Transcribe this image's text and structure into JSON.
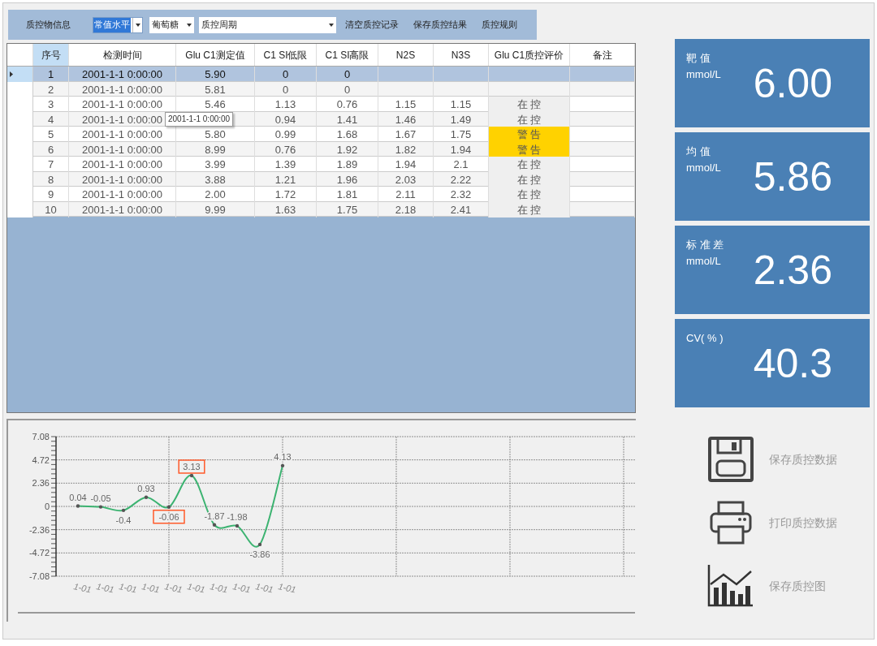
{
  "toolbar": {
    "label": "质控物信息",
    "level_select": {
      "value": "常值水平",
      "highlighted": true
    },
    "analyte_select": {
      "value": "葡萄糖"
    },
    "period_select": {
      "value": "质控周期"
    },
    "buttons": [
      "清空质控记录",
      "保存质控结果",
      "质控规则"
    ]
  },
  "table": {
    "columns": [
      {
        "label": "序号",
        "selected": true
      },
      {
        "label": "检测时间",
        "selected": false
      },
      {
        "label": "Glu C1测定值",
        "selected": false
      },
      {
        "label": "C1 SI低限",
        "selected": false
      },
      {
        "label": "C1 SI高限",
        "selected": false
      },
      {
        "label": "N2S",
        "selected": false
      },
      {
        "label": "N3S",
        "selected": false
      },
      {
        "label": "Glu C1质控评价",
        "selected": false
      },
      {
        "label": "备注",
        "selected": false
      }
    ],
    "rows": [
      {
        "selected": true,
        "cells": [
          "1",
          "2001-1-1 0:00:00",
          "5.90",
          "0",
          "0"
        ]
      },
      {
        "selected": false,
        "cells": [
          "2",
          "2001-1-1 0:00:00",
          "5.81",
          "0",
          "0"
        ]
      },
      {
        "selected": false,
        "cells": [
          "3",
          "2001-1-1 0:00:00",
          "5.46",
          "1.13",
          "0.76",
          "1.15",
          "1.15"
        ],
        "evaluation": {
          "text": "在 控",
          "kind": "normal"
        }
      },
      {
        "selected": false,
        "cells": [
          "4",
          "2001-1-1 0:00:00",
          null,
          "0.94",
          "1.41",
          "1.46",
          "1.49"
        ],
        "evaluation": {
          "text": "在 控",
          "kind": "normal"
        }
      },
      {
        "selected": false,
        "cells": [
          "5",
          "2001-1-1 0:00:00",
          "5.80",
          "0.99",
          "1.68",
          "1.67",
          "1.75"
        ],
        "evaluation": {
          "text": "警 告",
          "kind": "warning"
        }
      },
      {
        "selected": false,
        "cells": [
          "6",
          "2001-1-1 0:00:00",
          "8.99",
          "0.76",
          "1.92",
          "1.82",
          "1.94"
        ],
        "evaluation": {
          "text": "警 告",
          "kind": "warning"
        }
      },
      {
        "selected": false,
        "cells": [
          "7",
          "2001-1-1 0:00:00",
          "3.99",
          "1.39",
          "1.89",
          "1.94",
          "2.1"
        ],
        "evaluation": {
          "text": "在 控",
          "kind": "normal"
        }
      },
      {
        "selected": false,
        "cells": [
          "8",
          "2001-1-1 0:00:00",
          "3.88",
          "1.21",
          "1.96",
          "2.03",
          "2.22"
        ],
        "evaluation": {
          "text": "在 控",
          "kind": "normal"
        }
      },
      {
        "selected": false,
        "cells": [
          "9",
          "2001-1-1 0:00:00",
          "2.00",
          "1.72",
          "1.81",
          "2.11",
          "2.32"
        ],
        "evaluation": {
          "text": "在 控",
          "kind": "normal"
        }
      },
      {
        "selected": false,
        "cells": [
          "10",
          "2001-1-1 0:00:00",
          "9.99",
          "1.63",
          "1.75",
          "2.18",
          "2.41"
        ],
        "evaluation": {
          "text": "在 控",
          "kind": "normal"
        }
      }
    ],
    "tooltip": "2001-1-1 0:00:00"
  },
  "chart": {
    "chart_data": {
      "type": "line",
      "categories": [
        "1-01",
        "1-01",
        "1-01",
        "1-01",
        "1-01",
        "1-01",
        "1-01",
        "1-01",
        "1-01",
        "1-01"
      ],
      "series": [
        {
          "color": "#3cb371",
          "values": [
            0.04,
            -0.05,
            -0.4,
            0.93,
            -0.06,
            3.13,
            -1.87,
            -1.98,
            -3.86,
            4.13
          ]
        }
      ],
      "ylim": [
        -7.08,
        7.08
      ],
      "yticks": [
        -7.08,
        -4.72,
        -2.36,
        0,
        2.36,
        4.72,
        7.08
      ],
      "data_labels": true,
      "grid": true
    },
    "points": [
      {
        "highlighted": false
      },
      {
        "highlighted": false
      },
      {
        "highlighted": false
      },
      {
        "highlighted": false
      },
      {
        "highlighted": true
      },
      {
        "highlighted": true
      },
      {
        "highlighted": false
      },
      {
        "highlighted": false
      },
      {
        "highlighted": false
      },
      {
        "highlighted": false
      }
    ]
  },
  "stats": [
    {
      "label": "靶 值",
      "unit": "mmol/L",
      "value": "6.00"
    },
    {
      "label": "均 值",
      "unit": "mmol/L",
      "value": "5.86"
    },
    {
      "label": "标 准 差",
      "unit": "mmol/L",
      "value": "2.36"
    },
    {
      "label": "CV( % )",
      "value": "40.3"
    }
  ],
  "actions": [
    {
      "kind": "save",
      "label": "保存质控数据"
    },
    {
      "kind": "print",
      "label": "打印质控数据"
    },
    {
      "kind": "chart",
      "label": "保存质控图"
    }
  ]
}
